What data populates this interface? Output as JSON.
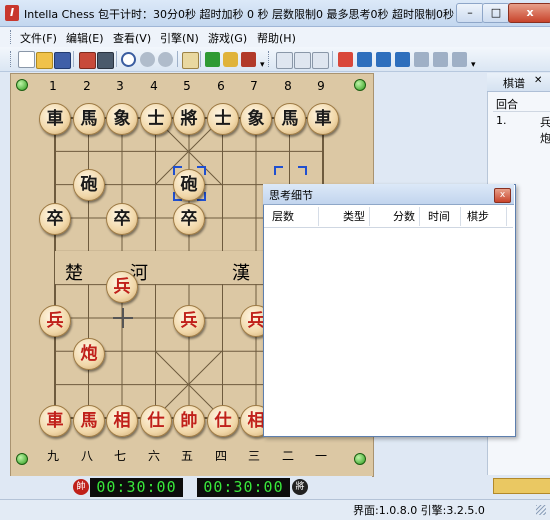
{
  "window": {
    "title": "Intella Chess 包干计时：30分0秒 超时加秒 0 秒 层数限制0 最多思考0秒 超时限制0秒",
    "icon_letter": "I",
    "min_label": "–",
    "max_label": "□",
    "close_label": "x"
  },
  "menu": [
    "文件(F)",
    "编辑(E)",
    "查看(V)",
    "引擎(N)",
    "游戏(G)",
    "帮助(H)"
  ],
  "board": {
    "col_numbers_top": [
      "1",
      "2",
      "3",
      "4",
      "5",
      "6",
      "7",
      "8",
      "9"
    ],
    "col_numbers_bottom": [
      "九",
      "八",
      "七",
      "六",
      "五",
      "四",
      "三",
      "二",
      "一"
    ],
    "river_left": [
      "楚",
      "河"
    ],
    "river_right": [
      "漢"
    ]
  },
  "pieces": [
    {
      "name": "black-chariot-1",
      "text": "車",
      "side": "black"
    },
    {
      "name": "black-horse-1",
      "text": "馬",
      "side": "black"
    },
    {
      "name": "black-elephant-1",
      "text": "象",
      "side": "black"
    },
    {
      "name": "black-advisor-1",
      "text": "士",
      "side": "black"
    },
    {
      "name": "black-general",
      "text": "將",
      "side": "black"
    },
    {
      "name": "black-advisor-2",
      "text": "士",
      "side": "black"
    },
    {
      "name": "black-elephant-2",
      "text": "象",
      "side": "black"
    },
    {
      "name": "black-horse-2",
      "text": "馬",
      "side": "black"
    },
    {
      "name": "black-chariot-2",
      "text": "車",
      "side": "black"
    },
    {
      "name": "black-cannon-1",
      "text": "砲",
      "side": "black"
    },
    {
      "name": "black-cannon-2",
      "text": "砲",
      "side": "black"
    },
    {
      "name": "black-soldier-1",
      "text": "卒",
      "side": "black"
    },
    {
      "name": "black-soldier-2",
      "text": "卒",
      "side": "black"
    },
    {
      "name": "black-soldier-3",
      "text": "卒",
      "side": "black"
    },
    {
      "name": "red-soldier-1",
      "text": "兵",
      "side": "red"
    },
    {
      "name": "red-soldier-2",
      "text": "兵",
      "side": "red"
    },
    {
      "name": "red-soldier-3",
      "text": "兵",
      "side": "red"
    },
    {
      "name": "red-soldier-4",
      "text": "兵",
      "side": "red"
    },
    {
      "name": "red-cannon-1",
      "text": "炮",
      "side": "red"
    },
    {
      "name": "red-chariot-1",
      "text": "車",
      "side": "red"
    },
    {
      "name": "red-horse-1",
      "text": "馬",
      "side": "red"
    },
    {
      "name": "red-elephant-1",
      "text": "相",
      "side": "red"
    },
    {
      "name": "red-advisor-1",
      "text": "仕",
      "side": "red"
    },
    {
      "name": "red-general",
      "text": "帥",
      "side": "red"
    },
    {
      "name": "red-advisor-2",
      "text": "仕",
      "side": "red"
    },
    {
      "name": "red-elephant-2",
      "text": "相",
      "side": "red"
    }
  ],
  "clocks": {
    "red_badge": "帥",
    "black_badge": "將",
    "red_time": "00:30:00",
    "black_time": "00:30:00"
  },
  "moves_panel": {
    "tab": "棋谱",
    "header_round": "回合",
    "rows": [
      {
        "round": "1.",
        "move": "兵"
      }
    ],
    "second_line": "炮"
  },
  "thinking_dialog": {
    "title": "思考细节",
    "close_label": "x",
    "columns": [
      "层数",
      "类型",
      "分数",
      "时间",
      "棋步"
    ]
  },
  "status": {
    "versions": "界面:1.0.8.0 引擎:3.2.5.0"
  },
  "colors": {
    "clock_digits": "#39e63b",
    "red_piece": "#c0201a",
    "selection": "#1f4fd0",
    "board": "#dcc8a4"
  }
}
